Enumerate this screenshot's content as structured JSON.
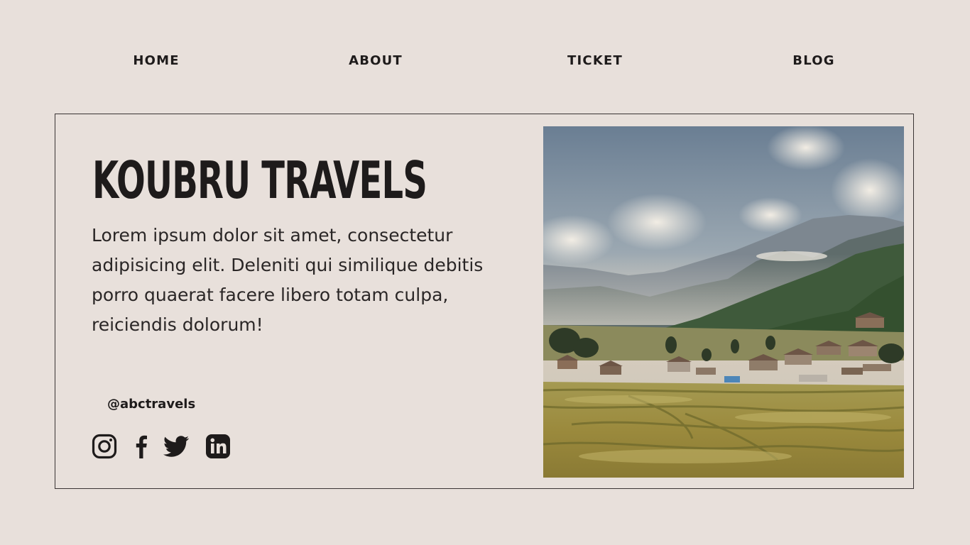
{
  "nav": {
    "items": [
      {
        "label": "HOME"
      },
      {
        "label": "ABOUT"
      },
      {
        "label": "TICKET"
      },
      {
        "label": "BLOG"
      }
    ]
  },
  "hero": {
    "title": "KOUBRU TRAVELS",
    "description": "Lorem ipsum dolor sit amet, consectetur adipisicing elit. Deleniti qui similique debitis porro quaerat facere libero totam culpa, reiciendis dolorum!",
    "handle": "@abctravels",
    "socials": [
      "instagram-icon",
      "facebook-icon",
      "twitter-icon",
      "linkedin-icon"
    ],
    "image": "mountain-village-rice-field-photo"
  },
  "colors": {
    "background": "#e8e0db",
    "text": "#1e1b1b",
    "border": "#3a3434"
  }
}
